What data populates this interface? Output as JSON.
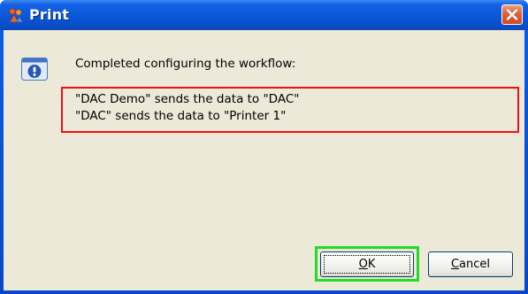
{
  "window": {
    "title": "Print",
    "icons": {
      "app": "print-app-icon",
      "close": "close-icon",
      "info": "info-icon"
    }
  },
  "message": {
    "heading": "Completed configuring the workflow:",
    "details": [
      "\"DAC Demo\" sends the data to \"DAC\"",
      "\"DAC\" sends the data to \"Printer 1\""
    ]
  },
  "buttons": {
    "ok": {
      "mnemonic": "O",
      "rest": "K"
    },
    "cancel": {
      "mnemonic": "C",
      "rest": "ancel"
    }
  },
  "colors": {
    "titlebar": "#0a56d8",
    "client": "#ece9d8",
    "highlight": "#ee1111",
    "ok_highlight": "#22dd22"
  }
}
